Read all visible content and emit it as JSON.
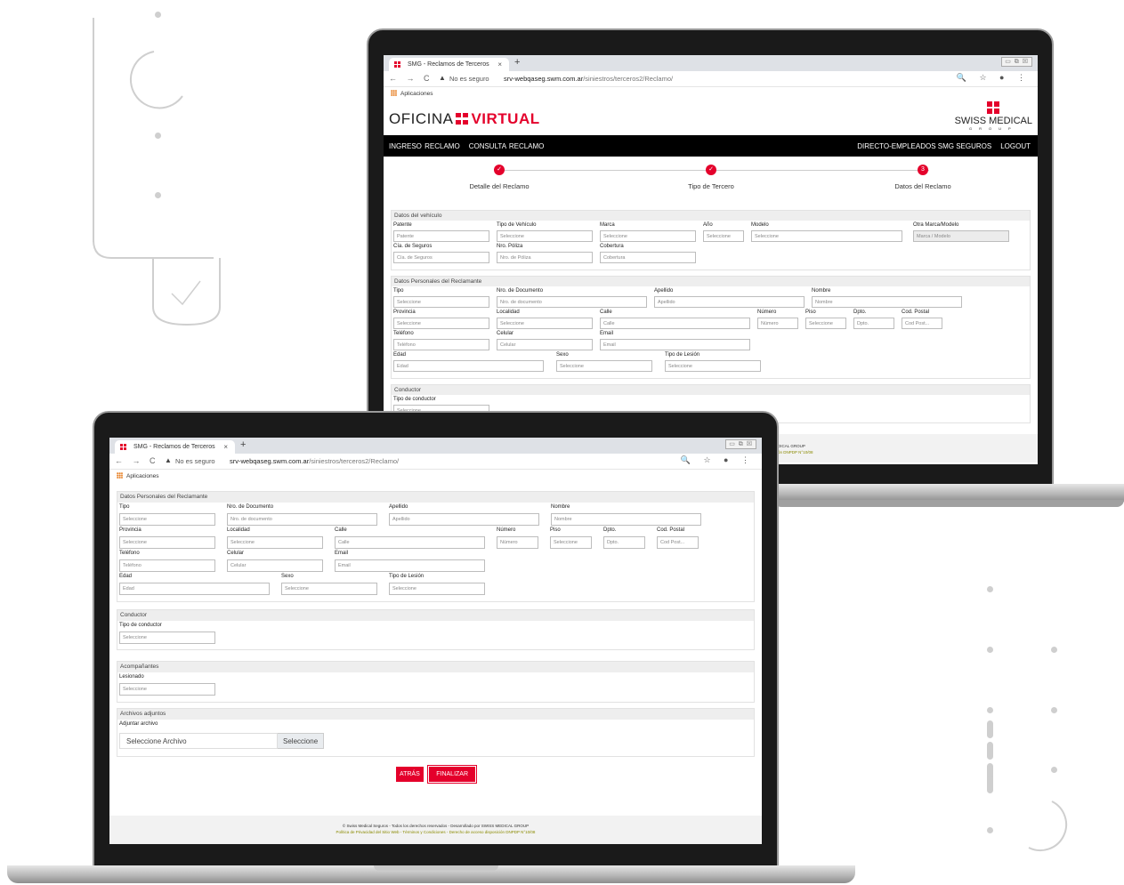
{
  "browser": {
    "tab_title": "SMG - Reclamos de Terceros",
    "tab_close": "×",
    "new_tab": "+",
    "window_controls": "▭ ⧉ ☒",
    "nav_icons": "← → C",
    "warning_icon": "▲",
    "security": "No es seguro",
    "url_host": "srv-webqaseg.swm.com.ar",
    "url_path": "/siniestros/terceros2/Reclamo/",
    "url_actions": "🔍 ☆ ● ⋮",
    "apps": "Aplicaciones"
  },
  "site": {
    "logo_left": "OFICINA",
    "logo_right": "VIRTUAL",
    "brand_name": "SWISS MEDICAL",
    "brand_group": "GROUP",
    "nav_left": [
      "INGRESO RECLAMO",
      "CONSULTA RECLAMO"
    ],
    "nav_right": [
      "DIRECTO-EMPLEADOS SMG SEGUROS",
      "LOGOUT"
    ]
  },
  "stepper": {
    "steps": [
      {
        "label": "Detalle del Reclamo",
        "mark": "✓"
      },
      {
        "label": "Tipo de Tercero",
        "mark": "✓"
      },
      {
        "label": "Datos del Reclamo",
        "mark": "3"
      }
    ]
  },
  "vehiculo": {
    "title": "Datos del vehículo",
    "patente": {
      "label": "Patente",
      "placeholder": "Patente"
    },
    "tipo": {
      "label": "Tipo de Vehículo",
      "placeholder": "Seleccione"
    },
    "marca": {
      "label": "Marca",
      "placeholder": "Seleccione"
    },
    "anio": {
      "label": "Año",
      "placeholder": "Seleccione"
    },
    "modelo": {
      "label": "Modelo",
      "placeholder": "Seleccione"
    },
    "otra": {
      "label": "Otra Marca/Modelo",
      "placeholder": "Marca / Modelo"
    },
    "cia": {
      "label": "Cía. de Seguros",
      "placeholder": "Cía. de Seguros"
    },
    "poliza": {
      "label": "Nro. Póliza",
      "placeholder": "Nro. de Póliza"
    },
    "cobertura": {
      "label": "Cobertura",
      "placeholder": "Cobertura"
    }
  },
  "personales": {
    "title": "Datos Personales del Reclamante",
    "tipo": {
      "label": "Tipo",
      "placeholder": "Seleccione"
    },
    "documento": {
      "label": "Nro. de Documento",
      "placeholder": "Nro. de documento"
    },
    "apellido": {
      "label": "Apellido",
      "placeholder": "Apellido"
    },
    "nombre": {
      "label": "Nombre",
      "placeholder": "Nombre"
    },
    "provincia": {
      "label": "Provincia",
      "placeholder": "Seleccione"
    },
    "localidad": {
      "label": "Localidad",
      "placeholder": "Seleccione"
    },
    "calle": {
      "label": "Calle",
      "placeholder": "Calle"
    },
    "numero": {
      "label": "Número",
      "placeholder": "Número"
    },
    "piso": {
      "label": "Piso",
      "placeholder": "Seleccione"
    },
    "dpto": {
      "label": "Dpto.",
      "placeholder": "Dpto."
    },
    "cp": {
      "label": "Cod. Postal",
      "placeholder": "Cod Post..."
    },
    "telefono": {
      "label": "Teléfono",
      "placeholder": "Teléfono"
    },
    "celular": {
      "label": "Celular",
      "placeholder": "Celular"
    },
    "email": {
      "label": "Email",
      "placeholder": "Email"
    },
    "edad": {
      "label": "Edad",
      "placeholder": "Edad"
    },
    "sexo": {
      "label": "Sexo",
      "placeholder": "Seleccione"
    },
    "lesion": {
      "label": "Tipo de Lesión",
      "placeholder": "Seleccione"
    }
  },
  "conductor": {
    "title": "Conductor",
    "tipo": {
      "label": "Tipo de conductor",
      "placeholder": "Seleccione"
    }
  },
  "acompanantes": {
    "title": "Acompañantes",
    "lesionado": {
      "label": "Lesionado",
      "placeholder": "Seleccione"
    }
  },
  "adjuntos": {
    "title": "Archivos adjuntos",
    "label": "Adjuntar archivo",
    "placeholder": "Seleccione Archivo",
    "button": "Seleccione"
  },
  "actions": {
    "back": "ATRÁS",
    "finish": "FINALIZAR"
  },
  "footer": {
    "line1": "© Swiss Medical Seguros - Todos los derechos reservados - Desarrollado por SWISS MEDICAL GROUP",
    "line2": "Política de Privacidad del Sitio Web - Términos y Condiciones - Derecho de acceso disposición DNPDP N°10/08",
    "partial_brand": "DICAL GROUP",
    "partial_policy": "ón DNPDP N°10/08"
  }
}
